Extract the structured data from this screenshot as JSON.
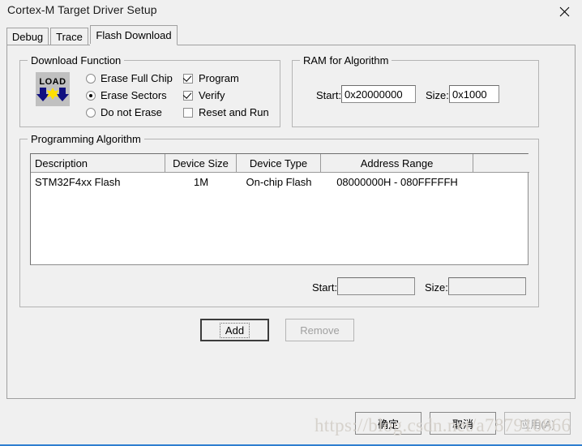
{
  "window": {
    "title": "Cortex-M Target Driver Setup",
    "close_icon": "close-icon"
  },
  "tabs": [
    {
      "label": "Debug",
      "active": false
    },
    {
      "label": "Trace",
      "active": false
    },
    {
      "label": "Flash Download",
      "active": true
    }
  ],
  "download_function": {
    "group_title": "Download Function",
    "icon": "load-icon",
    "icon_text": "LOAD",
    "erase_options": [
      {
        "label": "Erase Full Chip",
        "selected": false
      },
      {
        "label": "Erase Sectors",
        "selected": true
      },
      {
        "label": "Do not Erase",
        "selected": false
      }
    ],
    "checkboxes": [
      {
        "label": "Program",
        "checked": true
      },
      {
        "label": "Verify",
        "checked": true
      },
      {
        "label": "Reset and Run",
        "checked": false
      }
    ]
  },
  "ram_for_algorithm": {
    "group_title": "RAM for Algorithm",
    "start_label": "Start:",
    "start_value": "0x20000000",
    "size_label": "Size:",
    "size_value": "0x1000"
  },
  "programming_algorithm": {
    "group_title": "Programming Algorithm",
    "columns": [
      "Description",
      "Device Size",
      "Device Type",
      "Address Range",
      ""
    ],
    "rows": [
      {
        "description": "STM32F4xx Flash",
        "device_size": "1M",
        "device_type": "On-chip Flash",
        "address_range": "08000000H - 080FFFFFH",
        "extra": ""
      }
    ],
    "start_label": "Start:",
    "start_value": "",
    "size_label": "Size:",
    "size_value": ""
  },
  "actions": {
    "add_label": "Add",
    "remove_label": "Remove"
  },
  "footer": {
    "ok_label": "确定",
    "cancel_label": "取消",
    "apply_label": "应用(A)"
  },
  "watermark": {
    "text": "https://blog.csdn.net/a787910866"
  },
  "colors": {
    "dialog_bg": "#f0f0f0",
    "field_bg": "#ffffff",
    "border": "#a0a0a0",
    "accent_bottom": "#2f7fd0",
    "icon_arrow": "#101080",
    "icon_star": "#ffe000",
    "watermark": "#d6d2cc"
  }
}
